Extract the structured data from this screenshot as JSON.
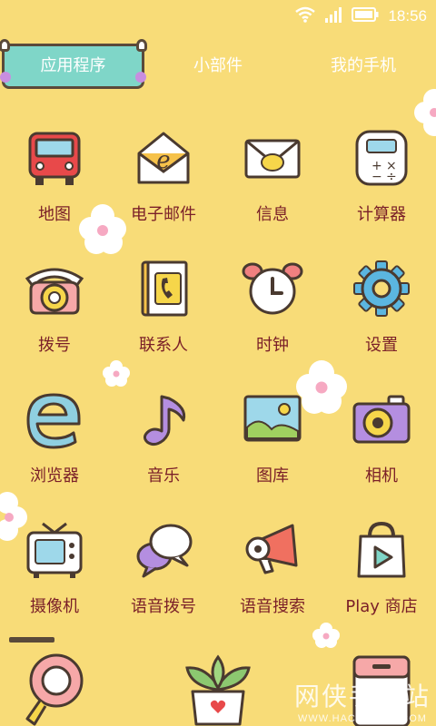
{
  "status": {
    "time": "18:56",
    "icons": [
      "wifi-icon",
      "signal-icon",
      "battery-icon"
    ]
  },
  "tabs": [
    {
      "label": "应用程序",
      "active": true
    },
    {
      "label": "小部件",
      "active": false
    },
    {
      "label": "我的手机",
      "active": false
    }
  ],
  "apps": [
    {
      "label": "地图",
      "icon": "bus-icon"
    },
    {
      "label": "电子邮件",
      "icon": "mail-envelope-icon"
    },
    {
      "label": "信息",
      "icon": "message-envelope-icon"
    },
    {
      "label": "计算器",
      "icon": "calculator-icon"
    },
    {
      "label": "拨号",
      "icon": "rotary-phone-icon"
    },
    {
      "label": "联系人",
      "icon": "contacts-book-icon"
    },
    {
      "label": "时钟",
      "icon": "alarm-clock-icon"
    },
    {
      "label": "设置",
      "icon": "gear-icon"
    },
    {
      "label": "浏览器",
      "icon": "browser-e-icon"
    },
    {
      "label": "音乐",
      "icon": "music-note-icon"
    },
    {
      "label": "图库",
      "icon": "gallery-picture-icon"
    },
    {
      "label": "相机",
      "icon": "camera-icon"
    },
    {
      "label": "摄像机",
      "icon": "tv-camcorder-icon"
    },
    {
      "label": "语音拨号",
      "icon": "speech-bubbles-icon"
    },
    {
      "label": "语音搜索",
      "icon": "megaphone-icon"
    },
    {
      "label": "Play 商店",
      "icon": "shopping-bag-play-icon"
    }
  ],
  "dock": [
    {
      "icon": "magnifier-icon"
    },
    {
      "icon": "plant-pot-icon"
    },
    {
      "icon": "cabinet-icon"
    }
  ],
  "watermark": {
    "text": "网侠手机站",
    "url": "WWW.HACKHOME.COM"
  },
  "colors": {
    "background": "#f8dc78",
    "label": "#7a1f28",
    "active_tab": "#7fd6c8"
  }
}
